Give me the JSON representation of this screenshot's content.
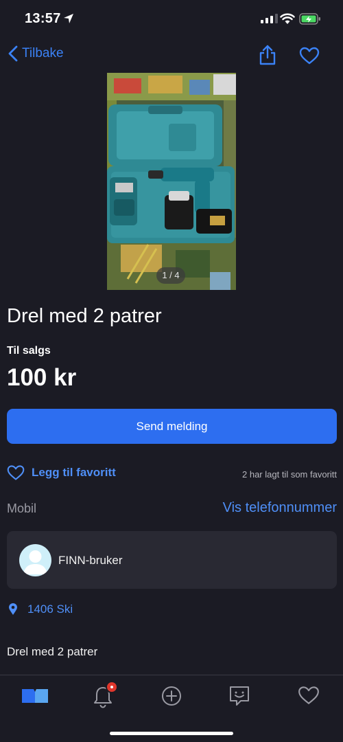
{
  "status_bar": {
    "time": "13:57"
  },
  "nav": {
    "back_label": "Tilbake"
  },
  "gallery": {
    "counter": "1 / 4"
  },
  "listing": {
    "title": "Drel med 2 patrer",
    "sale_type": "Til salgs",
    "price": "100 kr",
    "description": "Drel med 2 patrer"
  },
  "actions": {
    "send_message_label": "Send melding",
    "add_favorite_label": "Legg til favoritt",
    "favorite_count_text": "2 har lagt til som favoritt"
  },
  "contact": {
    "phone_label": "Mobil",
    "show_phone_label": "Vis telefonnummer"
  },
  "seller": {
    "name": "FINN-bruker"
  },
  "location": {
    "text": "1406 Ski"
  },
  "tabbar": {
    "items": [
      {
        "icon": "home-icon",
        "active": true
      },
      {
        "icon": "bell-icon",
        "has_badge": true
      },
      {
        "icon": "plus-circle-icon"
      },
      {
        "icon": "messages-icon"
      },
      {
        "icon": "heart-icon"
      }
    ]
  },
  "colors": {
    "background": "#1b1b24",
    "accent": "#2d6ef0",
    "link": "#4f8ff7",
    "card": "#292933",
    "badge": "#e0362c"
  }
}
